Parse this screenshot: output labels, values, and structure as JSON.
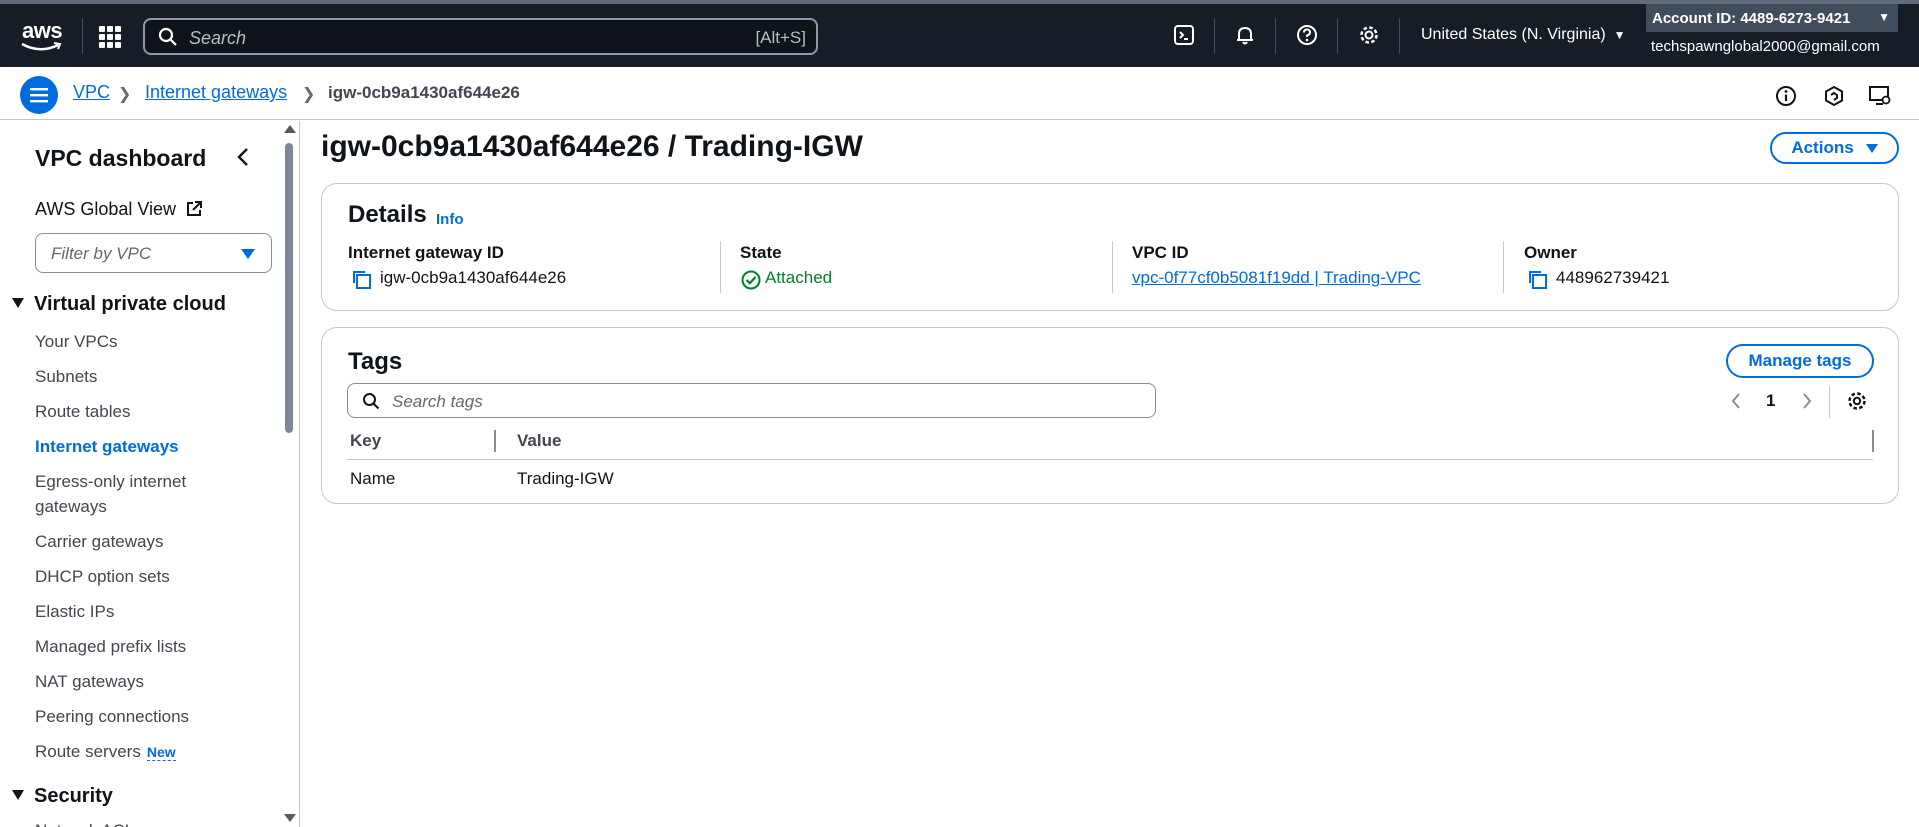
{
  "topnav": {
    "logo_text": "aws",
    "search_placeholder": "Search",
    "search_shortcut": "[Alt+S]",
    "region": "United States (N. Virginia)",
    "account_id": "Account ID: 4489-6273-9421",
    "email": "techspawnglobal2000@gmail.com",
    "icons": [
      "cloudshell-icon",
      "bell-icon",
      "help-icon",
      "gear-icon"
    ]
  },
  "breadcrumb": {
    "items": [
      "VPC",
      "Internet gateways"
    ],
    "current": "igw-0cb9a1430af644e26"
  },
  "sidebar": {
    "title": "VPC dashboard",
    "global_view": "AWS Global View",
    "filter_placeholder": "Filter by VPC",
    "section_vpc": "Virtual private cloud",
    "items": [
      "Your VPCs",
      "Subnets",
      "Route tables",
      "Internet gateways",
      "Egress-only internet gateways",
      "Carrier gateways",
      "DHCP option sets",
      "Elastic IPs",
      "Managed prefix lists",
      "NAT gateways",
      "Peering connections",
      "Route servers"
    ],
    "new_badge": "New",
    "section_security": "Security",
    "partial_item": "Network ACLs"
  },
  "main": {
    "title": "igw-0cb9a1430af644e26 / Trading-IGW",
    "actions_label": "Actions",
    "details": {
      "heading": "Details",
      "info": "Info",
      "fields": [
        {
          "label": "Internet gateway ID",
          "value": "igw-0cb9a1430af644e26"
        },
        {
          "label": "State",
          "value": "Attached"
        },
        {
          "label": "VPC ID",
          "value": "vpc-0f77cf0b5081f19dd | Trading-VPC"
        },
        {
          "label": "Owner",
          "value": "448962739421"
        }
      ]
    },
    "tags": {
      "heading": "Tags",
      "manage_label": "Manage tags",
      "search_placeholder": "Search tags",
      "page": "1",
      "columns": [
        "Key",
        "Value"
      ],
      "rows": [
        {
          "key": "Name",
          "value": "Trading-IGW"
        }
      ]
    }
  },
  "colors": {
    "nav_bg": "#161d26",
    "link": "#006ce0",
    "success": "#00802f"
  }
}
